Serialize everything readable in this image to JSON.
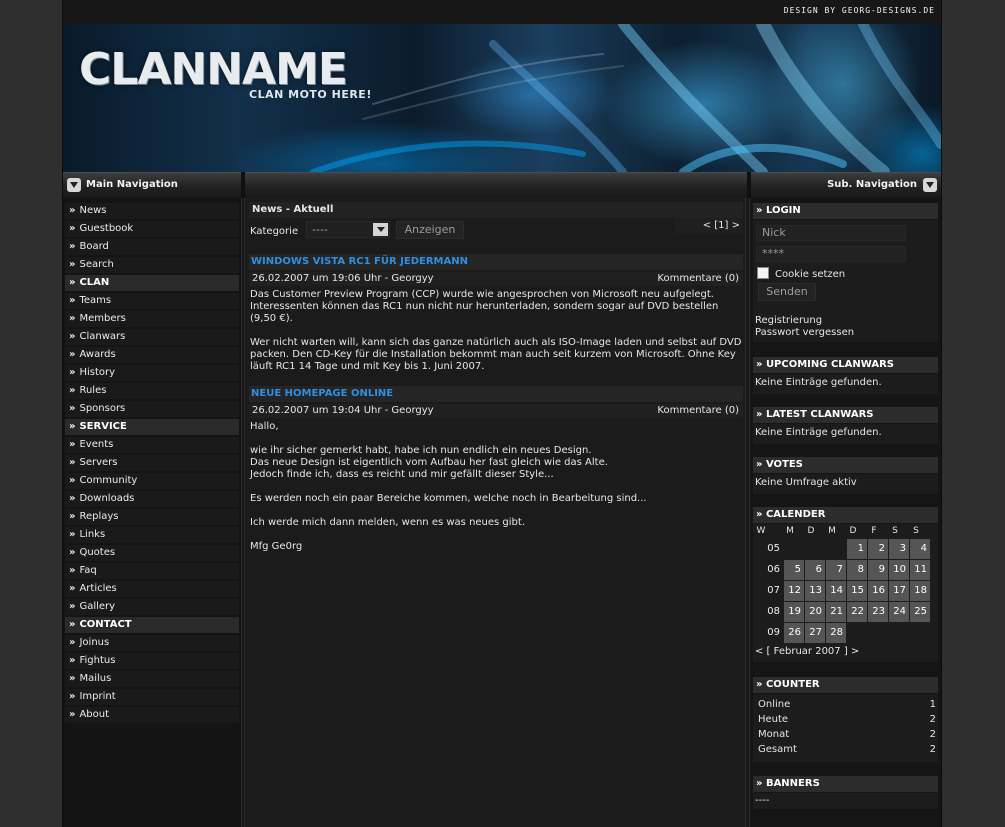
{
  "header": {
    "credit": "DESIGN BY GEORG-DESIGNS.DE",
    "clan_name": "CLANNAME",
    "clan_motto": "CLAN MOTO HERE!"
  },
  "nav": {
    "main_title": "Main Navigation",
    "sub_title": "Sub. Navigation"
  },
  "menu": [
    {
      "label": "News",
      "section": false
    },
    {
      "label": "Guestbook",
      "section": false
    },
    {
      "label": "Board",
      "section": false
    },
    {
      "label": "Search",
      "section": false
    },
    {
      "label": "CLAN",
      "section": true
    },
    {
      "label": "Teams",
      "section": false
    },
    {
      "label": "Members",
      "section": false
    },
    {
      "label": "Clanwars",
      "section": false
    },
    {
      "label": "Awards",
      "section": false
    },
    {
      "label": "History",
      "section": false
    },
    {
      "label": "Rules",
      "section": false
    },
    {
      "label": "Sponsors",
      "section": false
    },
    {
      "label": "SERVICE",
      "section": true
    },
    {
      "label": "Events",
      "section": false
    },
    {
      "label": "Servers",
      "section": false
    },
    {
      "label": "Community",
      "section": false
    },
    {
      "label": "Downloads",
      "section": false
    },
    {
      "label": "Replays",
      "section": false
    },
    {
      "label": "Links",
      "section": false
    },
    {
      "label": "Quotes",
      "section": false
    },
    {
      "label": "Faq",
      "section": false
    },
    {
      "label": "Articles",
      "section": false
    },
    {
      "label": "Gallery",
      "section": false
    },
    {
      "label": "CONTACT",
      "section": true
    },
    {
      "label": "Joinus",
      "section": false
    },
    {
      "label": "Fightus",
      "section": false
    },
    {
      "label": "Mailus",
      "section": false
    },
    {
      "label": "Imprint",
      "section": false
    },
    {
      "label": "About",
      "section": false
    }
  ],
  "center": {
    "title": "News - Aktuell",
    "kategorie_label": "Kategorie",
    "kategorie_value": "----",
    "show_button": "Anzeigen",
    "pagination": "< [1] >",
    "news": [
      {
        "title": "WINDOWS VISTA RC1 FÜR JEDERMANN",
        "meta": "26.02.2007 um 19:06 Uhr - Georgyy",
        "comments": "Kommentare (0)",
        "body": "Das Customer Preview Program (CCP) wurde wie angesprochen von Microsoft neu aufgelegt.\nInteressenten können das RC1 nun nicht nur herunterladen, sondern sogar auf DVD bestellen\n(9,50 €).\n\nWer nicht warten will, kann sich das ganze natürlich auch als ISO-Image laden und selbst auf DVD\npacken. Den CD-Key für die Installation bekommt man auch seit kurzem von Microsoft. Ohne Key\nläuft RC1 14 Tage und mit Key bis 1. Juni 2007."
      },
      {
        "title": "NEUE HOMEPAGE ONLINE",
        "meta": "26.02.2007 um 19:04 Uhr - Georgyy",
        "comments": "Kommentare (0)",
        "body": "Hallo,\n\nwie ihr sicher gemerkt habt, habe ich nun endlich ein neues Design.\nDas neue Design ist eigentlich vom Aufbau her fast gleich wie das Alte.\nJedoch finde ich, dass es reicht und mir gefällt dieser Style...\n\nEs werden noch ein paar Bereiche kommen, welche noch in Bearbeitung sind...\n\nIch werde mich dann melden, wenn es was neues gibt.\n\nMfg Ge0rg"
      }
    ]
  },
  "login": {
    "title": "» LOGIN",
    "user_value": "Nick",
    "pass_value": "****",
    "remember_label": "Cookie setzen",
    "send_button": "Senden",
    "register_link": "Registrierung",
    "forgot_link": "Passwort vergessen"
  },
  "upcoming": {
    "title": "» UPCOMING CLANWARS",
    "text": "Keine Einträge gefunden."
  },
  "latest": {
    "title": "» LATEST CLANWARS",
    "text": "Keine Einträge gefunden."
  },
  "votes": {
    "title": "» VOTES",
    "text": "Keine Umfrage aktiv"
  },
  "calendar": {
    "title": "» CALENDER",
    "weekdays": [
      "W",
      "M",
      "D",
      "M",
      "D",
      "F",
      "S",
      "S"
    ],
    "rows": [
      {
        "week": "05",
        "days": [
          "",
          "",
          "",
          "1",
          "2",
          "3",
          "4"
        ]
      },
      {
        "week": "06",
        "days": [
          "5",
          "6",
          "7",
          "8",
          "9",
          "10",
          "11"
        ]
      },
      {
        "week": "07",
        "days": [
          "12",
          "13",
          "14",
          "15",
          "16",
          "17",
          "18"
        ]
      },
      {
        "week": "08",
        "days": [
          "19",
          "20",
          "21",
          "22",
          "23",
          "24",
          "25"
        ]
      },
      {
        "week": "09",
        "days": [
          "26",
          "27",
          "28",
          "",
          "",
          "",
          ""
        ]
      }
    ],
    "nav": "< [ Februar 2007 ] >"
  },
  "counter": {
    "title": "» COUNTER",
    "rows": [
      {
        "label": "Online",
        "value": "1"
      },
      {
        "label": "Heute",
        "value": "2"
      },
      {
        "label": "Monat",
        "value": "2"
      },
      {
        "label": "Gesamt",
        "value": "2"
      }
    ]
  },
  "banners": {
    "title": "» BANNERS",
    "text": "----"
  }
}
